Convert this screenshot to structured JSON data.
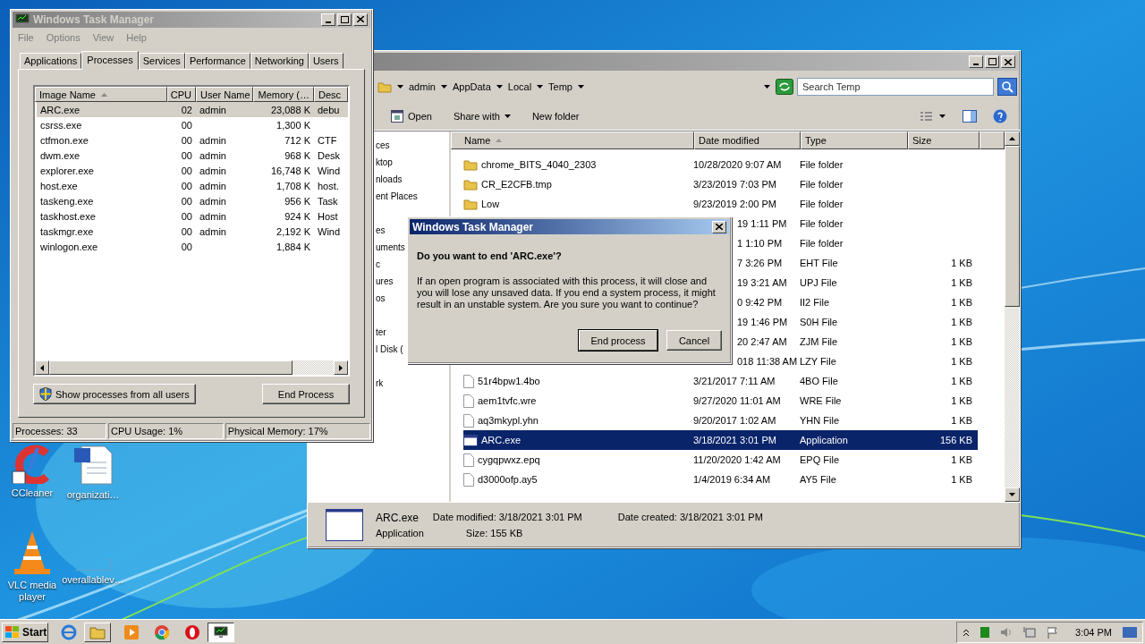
{
  "task_manager": {
    "title": "Windows Task Manager",
    "menu": [
      "File",
      "Options",
      "View",
      "Help"
    ],
    "tabs": [
      {
        "label": "Applications",
        "selected": false
      },
      {
        "label": "Processes",
        "selected": true
      },
      {
        "label": "Services",
        "selected": false
      },
      {
        "label": "Performance",
        "selected": false
      },
      {
        "label": "Networking",
        "selected": false
      },
      {
        "label": "Users",
        "selected": false
      }
    ],
    "columns": [
      {
        "label": "Image Name",
        "sorted": true
      },
      {
        "label": "CPU",
        "sorted": false
      },
      {
        "label": "User Name",
        "sorted": false
      },
      {
        "label": "Memory (…",
        "sorted": false
      },
      {
        "label": "Desc",
        "sorted": false
      }
    ],
    "rows": [
      {
        "cells": [
          "ARC.exe",
          "02",
          "admin",
          "23,088 K",
          "debu"
        ],
        "selected": true
      },
      {
        "cells": [
          "csrss.exe",
          "00",
          "",
          "1,300 K",
          ""
        ],
        "selected": false
      },
      {
        "cells": [
          "ctfmon.exe",
          "00",
          "admin",
          "712 K",
          "CTF"
        ],
        "selected": false
      },
      {
        "cells": [
          "dwm.exe",
          "00",
          "admin",
          "968 K",
          "Desk"
        ],
        "selected": false
      },
      {
        "cells": [
          "explorer.exe",
          "00",
          "admin",
          "16,748 K",
          "Wind"
        ],
        "selected": false
      },
      {
        "cells": [
          "host.exe",
          "00",
          "admin",
          "1,708 K",
          "host."
        ],
        "selected": false
      },
      {
        "cells": [
          "taskeng.exe",
          "00",
          "admin",
          "956 K",
          "Task"
        ],
        "selected": false
      },
      {
        "cells": [
          "taskhost.exe",
          "00",
          "admin",
          "924 K",
          "Host"
        ],
        "selected": false
      },
      {
        "cells": [
          "taskmgr.exe",
          "00",
          "admin",
          "2,192 K",
          "Wind"
        ],
        "selected": false
      },
      {
        "cells": [
          "winlogon.exe",
          "00",
          "",
          "1,884 K",
          ""
        ],
        "selected": false
      }
    ],
    "show_all_button": "Show processes from all users",
    "end_button": "End Process",
    "status": [
      "Processes: 33",
      "CPU Usage: 1%",
      "Physical Memory: 17%"
    ]
  },
  "explorer": {
    "breadcrumb": [
      "admin",
      "AppData",
      "Local",
      "Temp"
    ],
    "search": {
      "placeholder": "Search Temp"
    },
    "toolbar": [
      {
        "label": "Open",
        "dropdown": false
      },
      {
        "label": "Share with",
        "dropdown": true
      },
      {
        "label": "New folder",
        "dropdown": false
      }
    ],
    "nav": [
      [
        "ces",
        "ktop",
        "nloads",
        "ent Places"
      ],
      [
        "es",
        "uments",
        "c",
        "ures",
        "os"
      ],
      [
        "ter",
        "l Disk ("
      ],
      [
        "rk"
      ]
    ],
    "columns": [
      {
        "label": "Name",
        "sorted": true
      },
      {
        "label": "Date modified",
        "sorted": false
      },
      {
        "label": "Type",
        "sorted": false
      },
      {
        "label": "Size",
        "sorted": false
      }
    ],
    "rows": [
      {
        "kind": "folder",
        "name": "chrome_BITS_4040_2303",
        "date": "10/28/2020 9:07 AM",
        "type": "File folder",
        "size": "",
        "selected": false
      },
      {
        "kind": "folder",
        "name": "CR_E2CFB.tmp",
        "date": "3/23/2019 7:03 PM",
        "type": "File folder",
        "size": "",
        "selected": false
      },
      {
        "kind": "folder",
        "name": "Low",
        "date": "9/23/2019 2:00 PM",
        "type": "File folder",
        "size": "",
        "selected": false
      },
      {
        "kind": "covered",
        "name": "",
        "date": "19 1:11 PM",
        "type": "File folder",
        "size": "",
        "selected": false
      },
      {
        "kind": "covered",
        "name": "",
        "date": "1 1:10 PM",
        "type": "File folder",
        "size": "",
        "selected": false
      },
      {
        "kind": "covered",
        "name": "",
        "date": "7 3:26 PM",
        "type": "EHT File",
        "size": "1 KB",
        "selected": false
      },
      {
        "kind": "covered",
        "name": "",
        "date": "19 3:21 AM",
        "type": "UPJ File",
        "size": "1 KB",
        "selected": false
      },
      {
        "kind": "covered",
        "name": "",
        "date": "0 9:42 PM",
        "type": "II2 File",
        "size": "1 KB",
        "selected": false
      },
      {
        "kind": "covered",
        "name": "",
        "date": "19 1:46 PM",
        "type": "S0H File",
        "size": "1 KB",
        "selected": false
      },
      {
        "kind": "covered",
        "name": "",
        "date": "20 2:47 AM",
        "type": "ZJM File",
        "size": "1 KB",
        "selected": false
      },
      {
        "kind": "covered",
        "name": "",
        "date": "018 11:38 AM",
        "type": "LZY File",
        "size": "1 KB",
        "selected": false
      },
      {
        "kind": "file",
        "name": "51r4bpw1.4bo",
        "date": "3/21/2017 7:11 AM",
        "type": "4BO File",
        "size": "1 KB",
        "selected": false
      },
      {
        "kind": "file",
        "name": "aem1tvfc.wre",
        "date": "9/27/2020 11:01 AM",
        "type": "WRE File",
        "size": "1 KB",
        "selected": false
      },
      {
        "kind": "file",
        "name": "aq3mkypl.yhn",
        "date": "9/20/2017 1:02 AM",
        "type": "YHN File",
        "size": "1 KB",
        "selected": false
      },
      {
        "kind": "app",
        "name": "ARC.exe",
        "date": "3/18/2021 3:01 PM",
        "type": "Application",
        "size": "156 KB",
        "selected": true
      },
      {
        "kind": "file",
        "name": "cygqpwxz.epq",
        "date": "11/20/2020 1:42 AM",
        "type": "EPQ File",
        "size": "1 KB",
        "selected": false
      },
      {
        "kind": "file",
        "name": "d3000ofp.ay5",
        "date": "1/4/2019 6:34 AM",
        "type": "AY5 File",
        "size": "1 KB",
        "selected": false
      }
    ],
    "details": {
      "name": "ARC.exe",
      "type": "Application",
      "modified": {
        "label": "Date modified:",
        "value": "3/18/2021 3:01 PM"
      },
      "created": {
        "label": "Date created:",
        "value": "3/18/2021 3:01 PM"
      },
      "size": {
        "label": "Size:",
        "value": "155 KB"
      }
    }
  },
  "dialog": {
    "title": "Windows Task Manager",
    "heading": "Do you want to end 'ARC.exe'?",
    "message": "If an open program is associated with this process, it will close and you will lose any unsaved data. If you end a system process, it might result in an unstable system. Are you sure you want to continue?",
    "buttons": [
      {
        "label": "End process",
        "default": true
      },
      {
        "label": "Cancel",
        "default": false
      }
    ]
  },
  "desktop_icons": [
    {
      "kind": "ccleaner",
      "label": "CCleaner"
    },
    {
      "kind": "document",
      "label": "organizati…"
    },
    {
      "kind": "vlc",
      "label": "VLC media player"
    },
    {
      "kind": "blank",
      "label": "overallablev…"
    }
  ],
  "taskbar": {
    "start": "Start",
    "apps": [
      {
        "kind": "ie",
        "open": false,
        "selected": false
      },
      {
        "kind": "folder",
        "open": true,
        "selected": false
      },
      {
        "kind": "media",
        "open": false,
        "selected": false
      },
      {
        "kind": "chrome",
        "open": false,
        "selected": false
      },
      {
        "kind": "opera",
        "open": false,
        "selected": false
      },
      {
        "kind": "taskmgr",
        "open": true,
        "selected": true
      }
    ],
    "clock": "3:04 PM"
  }
}
